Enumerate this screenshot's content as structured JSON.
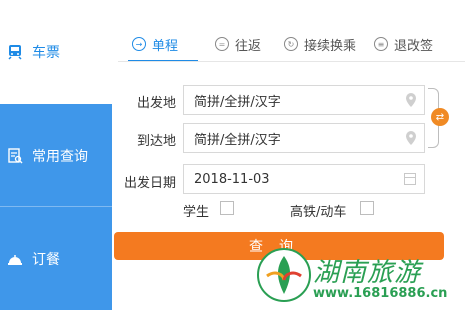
{
  "sidebar": {
    "items": [
      {
        "label": "车票",
        "icon": "train-icon"
      },
      {
        "label": "常用查询",
        "icon": "query-doc-icon"
      },
      {
        "label": "订餐",
        "icon": "meal-bell-icon"
      }
    ]
  },
  "tabs": [
    {
      "label": "单程",
      "icon": "arrow-right-icon",
      "active": true
    },
    {
      "label": "往返",
      "icon": "equals-icon",
      "active": false
    },
    {
      "label": "接续换乘",
      "icon": "cycle-icon",
      "active": false
    },
    {
      "label": "退改签",
      "icon": "list-icon",
      "active": false
    }
  ],
  "form": {
    "from_label": "出发地",
    "from_placeholder": "简拼/全拼/汉字",
    "to_label": "到达地",
    "to_placeholder": "简拼/全拼/汉字",
    "date_label": "出发日期",
    "date_value": "2018-11-03",
    "student_label": "学生",
    "highspeed_label": "高铁/动车",
    "search_label": "查询"
  },
  "watermark": {
    "title": "湖南旅游",
    "url": "www.16816886.cn"
  },
  "colors": {
    "accent": "#1f8be6",
    "sidebar_bg": "#3f97ea",
    "button": "#f47a20",
    "watermark": "#2a9f53"
  }
}
